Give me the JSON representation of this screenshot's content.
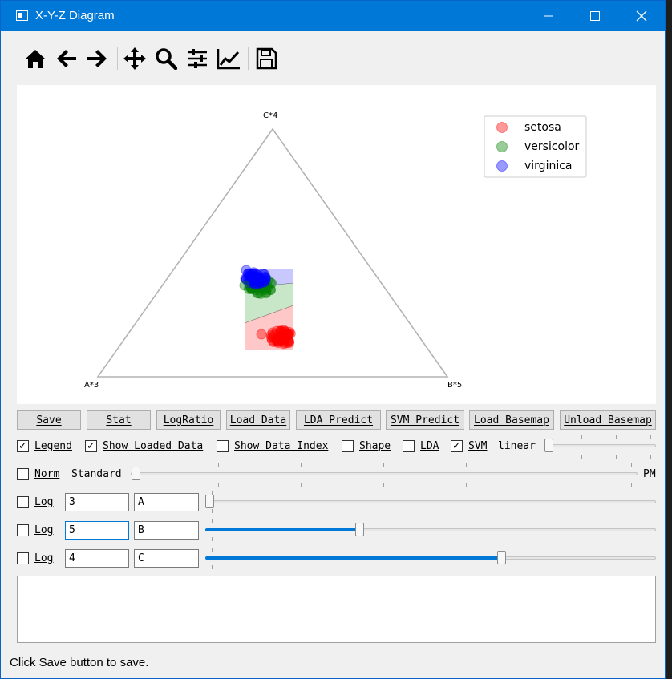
{
  "window": {
    "title": "X-Y-Z Diagram"
  },
  "toolbar": {
    "icons": [
      "home-icon",
      "back-arrow-icon",
      "forward-arrow-icon",
      "pan-icon",
      "zoom-icon",
      "configure-subplots-icon",
      "edit-curves-icon",
      "save-icon"
    ]
  },
  "plot": {
    "labels": {
      "top": "C*4",
      "left": "A*3",
      "right": "B*5"
    },
    "legend": [
      {
        "name": "setosa",
        "color": "#ff0000"
      },
      {
        "name": "versicolor",
        "color": "#008000"
      },
      {
        "name": "virginica",
        "color": "#0000ff"
      }
    ]
  },
  "buttons": {
    "save": "Save",
    "stat": "Stat",
    "logratio": "LogRatio",
    "load_data": "Load Data",
    "lda_predict": "LDA Predict",
    "svm_predict": "SVM Predict",
    "load_basemap": "Load Basemap",
    "unload_basemap": "Unload Basemap"
  },
  "options": {
    "legend": {
      "label": "Legend",
      "checked": true
    },
    "show_loaded": {
      "label": "Show Loaded Data",
      "checked": true
    },
    "show_index": {
      "label": "Show Data Index",
      "checked": false
    },
    "shape": {
      "label": "Shape",
      "checked": false
    },
    "lda": {
      "label": "LDA",
      "checked": false
    },
    "svm": {
      "label": "SVM",
      "checked": true
    },
    "kernel": "linear"
  },
  "norm": {
    "label": "Norm",
    "method": "Standard",
    "end_label": "PM",
    "checked": false
  },
  "rows": [
    {
      "log_label": "Log",
      "value": "3",
      "name": "A",
      "level": 0.0
    },
    {
      "log_label": "Log",
      "value": "5",
      "name": "B",
      "level": 0.34
    },
    {
      "log_label": "Log",
      "value": "4",
      "name": "C",
      "level": 0.66
    }
  ],
  "status": "Click Save button to save."
}
